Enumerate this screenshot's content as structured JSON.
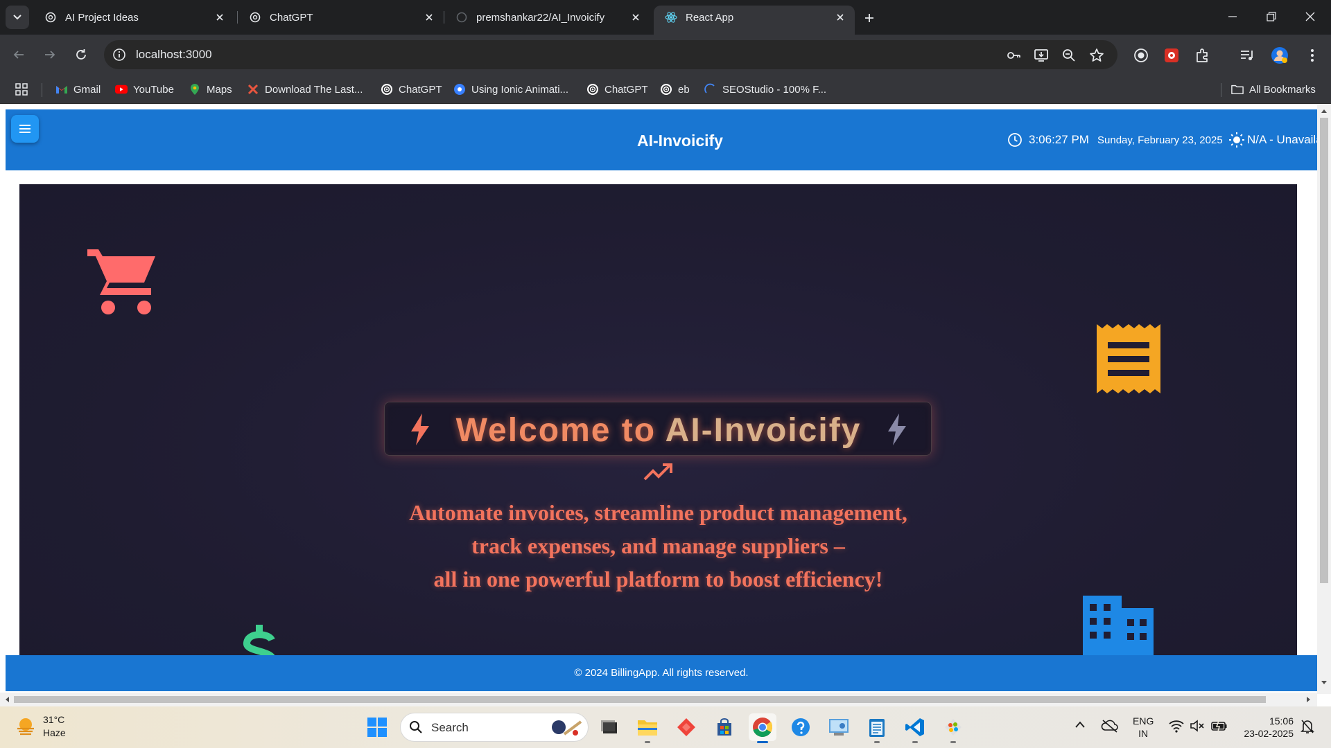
{
  "browser": {
    "tabs": [
      {
        "title": "AI Project Ideas",
        "active": false
      },
      {
        "title": "ChatGPT",
        "active": false
      },
      {
        "title": "premshankar22/AI_Invoicify",
        "active": false
      },
      {
        "title": "React App",
        "active": true
      }
    ],
    "url": "localhost:3000",
    "bookmarks": [
      {
        "label": "Gmail"
      },
      {
        "label": "YouTube"
      },
      {
        "label": "Maps"
      },
      {
        "label": "Download The Last..."
      },
      {
        "label": "ChatGPT"
      },
      {
        "label": "Using Ionic Animati..."
      },
      {
        "label": "ChatGPT"
      },
      {
        "label": "eb"
      },
      {
        "label": "SEOStudio - 100% F..."
      }
    ],
    "all_bookmarks_label": "All Bookmarks"
  },
  "app": {
    "header": {
      "title": "AI-Invoicify",
      "time": "3:06:27 PM",
      "date": "Sunday, February 23, 2025",
      "weather": "N/A - Unavaila"
    },
    "hero": {
      "welcome_prefix": "Welcome to ",
      "welcome_brand": "AI-Invoicify",
      "tagline_lines": [
        "Automate invoices, streamline product management,",
        "track expenses, and manage suppliers –",
        "all in one powerful platform to boost efficiency!"
      ]
    },
    "footer": {
      "text": "© 2024 BillingApp. All rights reserved."
    }
  },
  "taskbar": {
    "weather_temp": "31°C",
    "weather_desc": "Haze",
    "search_placeholder": "Search",
    "lang_line1": "ENG",
    "lang_line2": "IN",
    "time": "15:06",
    "date": "23-02-2025"
  },
  "colors": {
    "header_blue": "#1976d2",
    "hero_bg": "#201d33",
    "cart": "#ff6b6b",
    "receipt": "#f5a623",
    "building": "#1e88e5",
    "dollar": "#3ecf8e",
    "tagline": "#f2735d"
  }
}
